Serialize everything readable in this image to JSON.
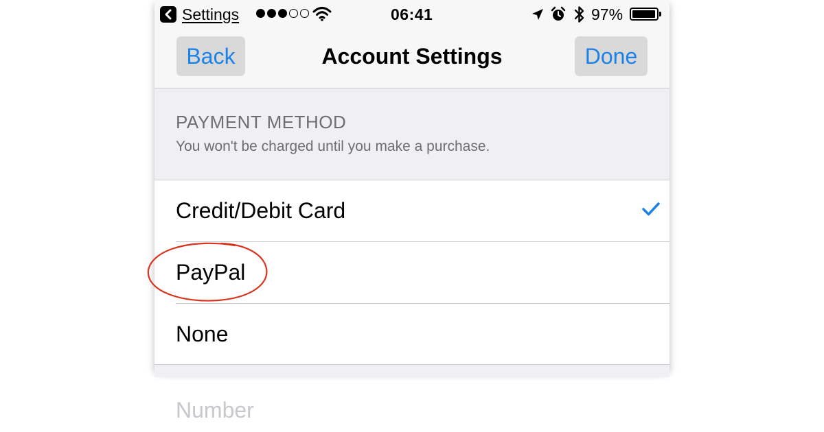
{
  "status_bar": {
    "back_app": "Settings",
    "signal_bars_filled": 3,
    "signal_bars_total": 5,
    "time": "06:41",
    "battery_percent": "97%",
    "battery_level": 0.97,
    "icons": [
      "back-arrow-icon",
      "wifi-icon",
      "location-arrow-icon",
      "alarm-clock-icon",
      "bluetooth-icon",
      "battery-icon"
    ]
  },
  "nav": {
    "back_label": "Back",
    "title": "Account Settings",
    "done_label": "Done"
  },
  "section": {
    "title": "PAYMENT METHOD",
    "footnote": "You won't be charged until you make a purchase."
  },
  "options": [
    {
      "label": "Credit/Debit Card",
      "selected": true
    },
    {
      "label": "PayPal",
      "selected": false,
      "highlighted": true
    },
    {
      "label": "None",
      "selected": false
    }
  ],
  "next_field_label": "Number",
  "colors": {
    "accent": "#1a82e6",
    "highlight_ring": "#d9341e",
    "group_background": "#efeff4",
    "separator": "#c8c7cc"
  }
}
